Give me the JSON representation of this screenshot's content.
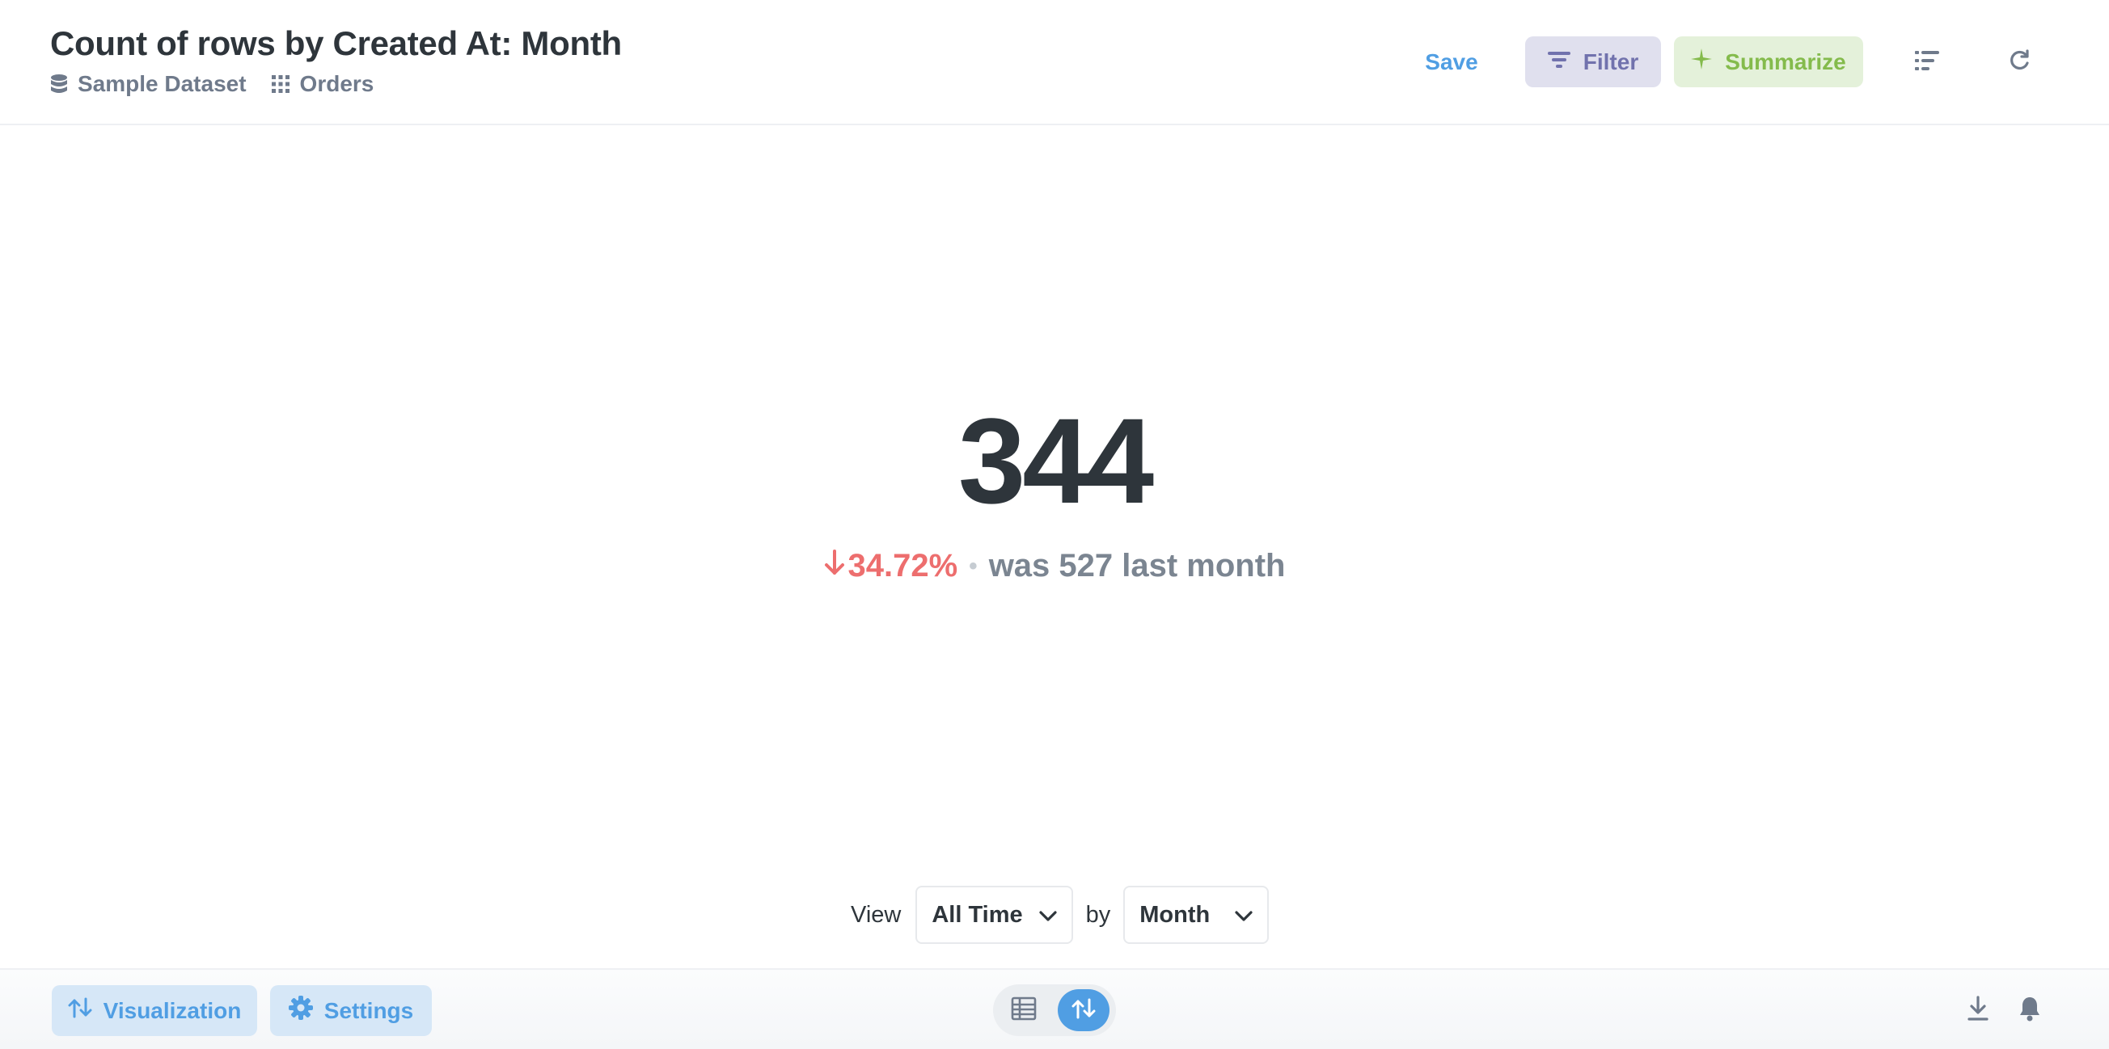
{
  "header": {
    "title": "Count of rows by Created At: Month",
    "breadcrumbs": [
      {
        "label": "Sample Dataset",
        "icon": "database-icon"
      },
      {
        "label": "Orders",
        "icon": "table-grid-icon"
      }
    ],
    "save_label": "Save",
    "filter_label": "Filter",
    "summarize_label": "Summarize",
    "icons": [
      "notebook-icon",
      "refresh-icon"
    ]
  },
  "scalar": {
    "value": "344",
    "change": "34.72%",
    "change_direction": "down",
    "separator": "•",
    "previous": "was 527 last month",
    "colors": {
      "negative": "#ed6e6e",
      "muted": "#7b8591"
    }
  },
  "controls": {
    "view_label": "View",
    "time_range": "All Time",
    "by_label": "by",
    "granularity": "Month"
  },
  "footer": {
    "visualization_label": "Visualization",
    "settings_label": "Settings",
    "view_toggle": [
      "table-icon",
      "scalar-trend-icon"
    ],
    "active_view": "scalar-trend-icon",
    "icons": [
      "download-icon",
      "bell-icon"
    ]
  },
  "colors": {
    "brand": "#509ee3",
    "filter": "#7172ad",
    "summarize": "#84bb4c"
  }
}
